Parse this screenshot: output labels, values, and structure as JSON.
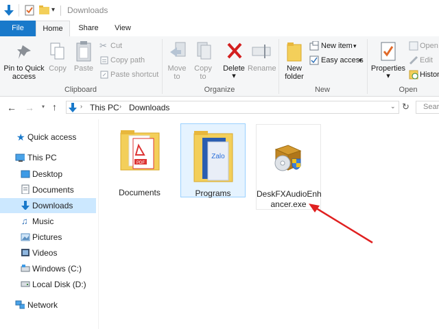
{
  "window": {
    "title": "Downloads"
  },
  "tabs": [
    {
      "label": "File"
    },
    {
      "label": "Home"
    },
    {
      "label": "Share"
    },
    {
      "label": "View"
    }
  ],
  "ribbon": {
    "clipboard": {
      "pin_label_1": "Pin to Quick",
      "pin_label_2": "access",
      "copy": "Copy",
      "paste": "Paste",
      "cut": "Cut",
      "copy_path": "Copy path",
      "paste_shortcut": "Paste shortcut",
      "group": "Clipboard"
    },
    "organize": {
      "move_to": "Move",
      "move_to_2": "to",
      "copy_to": "Copy",
      "copy_to_2": "to",
      "delete": "Delete",
      "rename": "Rename",
      "group": "Organize"
    },
    "new": {
      "new_folder_1": "New",
      "new_folder_2": "folder",
      "new_item": "New item",
      "easy_access": "Easy access",
      "group": "New"
    },
    "open": {
      "properties": "Properties",
      "open": "Open",
      "edit": "Edit",
      "history": "Histor",
      "group": "Open"
    }
  },
  "address": {
    "crumbs": [
      "This PC",
      "Downloads"
    ],
    "search_placeholder": "Sear"
  },
  "nav": {
    "quick_access": "Quick access",
    "this_pc": "This PC",
    "desktop": "Desktop",
    "documents": "Documents",
    "downloads": "Downloads",
    "music": "Music",
    "pictures": "Pictures",
    "videos": "Videos",
    "windows_c": "Windows (C:)",
    "local_d": "Local Disk (D:)",
    "network": "Network"
  },
  "files": [
    {
      "name": "Documents"
    },
    {
      "name": "Programs"
    },
    {
      "name_line1": "DeskFXAudioEnh",
      "name_line2": "ancer.exe"
    }
  ],
  "colors": {
    "accent": "#1979ca",
    "selected": "#cce8ff",
    "annotation_arrow": "#e02020"
  }
}
